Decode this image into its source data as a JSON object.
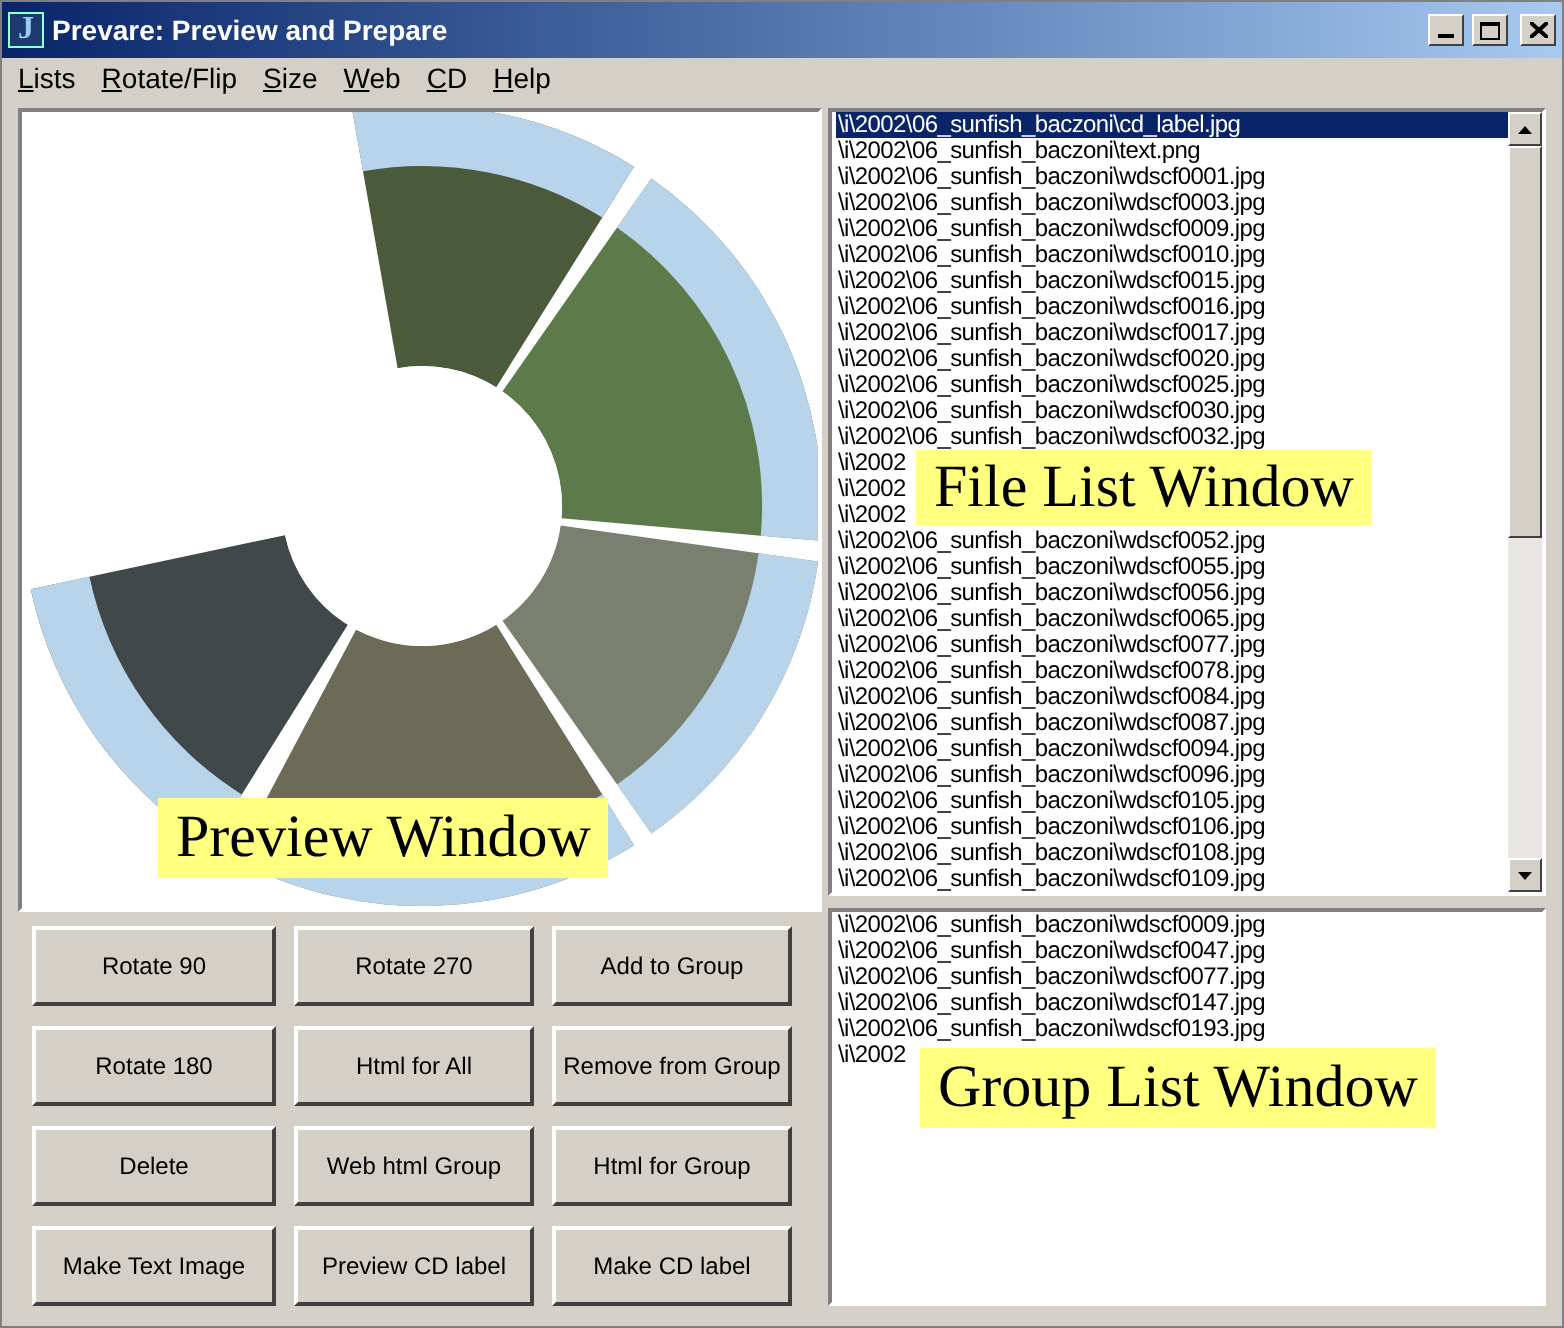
{
  "window": {
    "title": "Prevare: Preview and Prepare",
    "icon_letter": "J"
  },
  "menu": [
    {
      "label": "Lists"
    },
    {
      "label": "Rotate/Flip"
    },
    {
      "label": "Size"
    },
    {
      "label": "Web"
    },
    {
      "label": "CD"
    },
    {
      "label": "Help"
    }
  ],
  "preview": {
    "kind": "picture",
    "callout": "Preview Window"
  },
  "file_list": {
    "callout": "File List Window",
    "items": [
      {
        "text": "\\i\\2002\\06_sunfish_baczoni\\cd_label.jpg",
        "selected": true
      },
      {
        "text": "\\i\\2002\\06_sunfish_baczoni\\text.png",
        "selected": false
      },
      {
        "text": "\\i\\2002\\06_sunfish_baczoni\\wdscf0001.jpg",
        "selected": false
      },
      {
        "text": "\\i\\2002\\06_sunfish_baczoni\\wdscf0003.jpg",
        "selected": false
      },
      {
        "text": "\\i\\2002\\06_sunfish_baczoni\\wdscf0009.jpg",
        "selected": false
      },
      {
        "text": "\\i\\2002\\06_sunfish_baczoni\\wdscf0010.jpg",
        "selected": false
      },
      {
        "text": "\\i\\2002\\06_sunfish_baczoni\\wdscf0015.jpg",
        "selected": false
      },
      {
        "text": "\\i\\2002\\06_sunfish_baczoni\\wdscf0016.jpg",
        "selected": false
      },
      {
        "text": "\\i\\2002\\06_sunfish_baczoni\\wdscf0017.jpg",
        "selected": false
      },
      {
        "text": "\\i\\2002\\06_sunfish_baczoni\\wdscf0020.jpg",
        "selected": false
      },
      {
        "text": "\\i\\2002\\06_sunfish_baczoni\\wdscf0025.jpg",
        "selected": false
      },
      {
        "text": "\\i\\2002\\06_sunfish_baczoni\\wdscf0030.jpg",
        "selected": false
      },
      {
        "text": "\\i\\2002\\06_sunfish_baczoni\\wdscf0032.jpg",
        "selected": false
      },
      {
        "text": "\\i\\2002",
        "selected": false
      },
      {
        "text": "\\i\\2002",
        "selected": false
      },
      {
        "text": "\\i\\2002",
        "selected": false
      },
      {
        "text": "\\i\\2002\\06_sunfish_baczoni\\wdscf0052.jpg",
        "selected": false
      },
      {
        "text": "\\i\\2002\\06_sunfish_baczoni\\wdscf0055.jpg",
        "selected": false
      },
      {
        "text": "\\i\\2002\\06_sunfish_baczoni\\wdscf0056.jpg",
        "selected": false
      },
      {
        "text": "\\i\\2002\\06_sunfish_baczoni\\wdscf0065.jpg",
        "selected": false
      },
      {
        "text": "\\i\\2002\\06_sunfish_baczoni\\wdscf0077.jpg",
        "selected": false
      },
      {
        "text": "\\i\\2002\\06_sunfish_baczoni\\wdscf0078.jpg",
        "selected": false
      },
      {
        "text": "\\i\\2002\\06_sunfish_baczoni\\wdscf0084.jpg",
        "selected": false
      },
      {
        "text": "\\i\\2002\\06_sunfish_baczoni\\wdscf0087.jpg",
        "selected": false
      },
      {
        "text": "\\i\\2002\\06_sunfish_baczoni\\wdscf0094.jpg",
        "selected": false
      },
      {
        "text": "\\i\\2002\\06_sunfish_baczoni\\wdscf0096.jpg",
        "selected": false
      },
      {
        "text": "\\i\\2002\\06_sunfish_baczoni\\wdscf0105.jpg",
        "selected": false
      },
      {
        "text": "\\i\\2002\\06_sunfish_baczoni\\wdscf0106.jpg",
        "selected": false
      },
      {
        "text": "\\i\\2002\\06_sunfish_baczoni\\wdscf0108.jpg",
        "selected": false
      },
      {
        "text": "\\i\\2002\\06_sunfish_baczoni\\wdscf0109.jpg",
        "selected": false
      }
    ]
  },
  "buttons": [
    "Rotate 90",
    "Rotate 270",
    "Add to Group",
    "Rotate 180",
    "Html for All",
    "Remove from Group",
    "Delete",
    "Web html Group",
    "Html for Group",
    "Make Text Image",
    "Preview CD label",
    "Make CD label"
  ],
  "group_list": {
    "callout": "Group List Window",
    "items": [
      "\\i\\2002\\06_sunfish_baczoni\\wdscf0009.jpg",
      "\\i\\2002\\06_sunfish_baczoni\\wdscf0047.jpg",
      "\\i\\2002\\06_sunfish_baczoni\\wdscf0077.jpg",
      "\\i\\2002\\06_sunfish_baczoni\\wdscf0147.jpg",
      "\\i\\2002\\06_sunfish_baczoni\\wdscf0193.jpg",
      "\\i\\2002"
    ]
  }
}
